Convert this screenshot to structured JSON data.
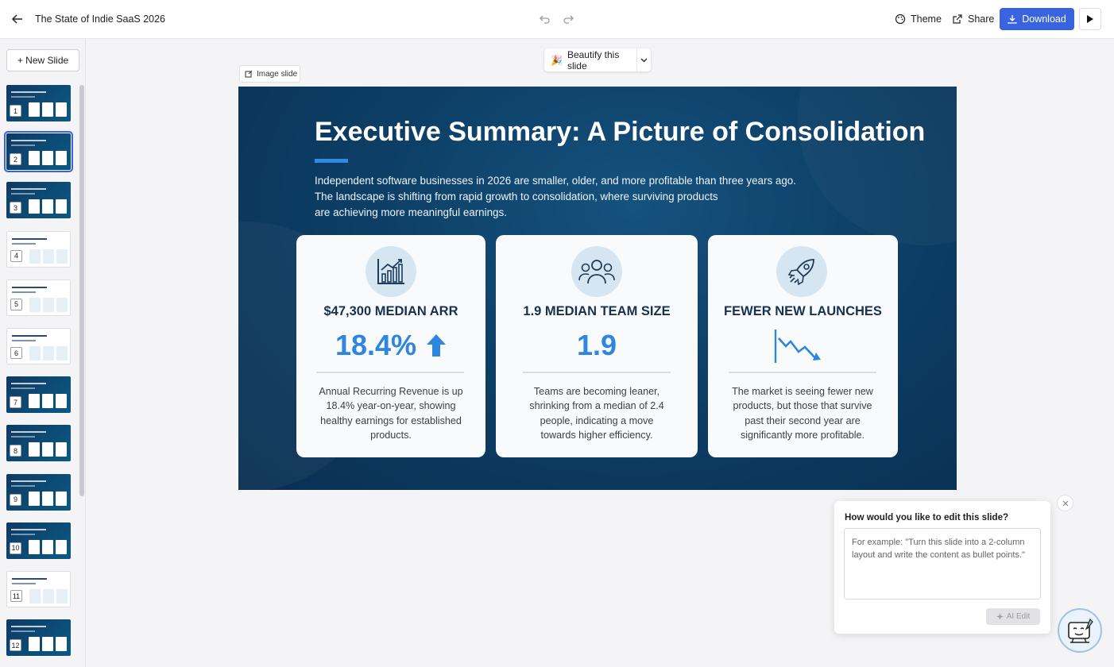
{
  "header": {
    "title": "The State of Indie SaaS 2026",
    "theme_label": "Theme",
    "share_label": "Share",
    "download_label": "Download"
  },
  "sidebar": {
    "new_slide_label": "+ New Slide",
    "selected_index": 2,
    "thumbnails": [
      {
        "number": "1",
        "style": "dark"
      },
      {
        "number": "2",
        "style": "dark"
      },
      {
        "number": "3",
        "style": "dark"
      },
      {
        "number": "4",
        "style": "light"
      },
      {
        "number": "5",
        "style": "light"
      },
      {
        "number": "6",
        "style": "light"
      },
      {
        "number": "7",
        "style": "dark"
      },
      {
        "number": "8",
        "style": "dark"
      },
      {
        "number": "9",
        "style": "dark"
      },
      {
        "number": "10",
        "style": "dark"
      },
      {
        "number": "11",
        "style": "light"
      },
      {
        "number": "12",
        "style": "dark"
      }
    ]
  },
  "canvas": {
    "beautify_label": "Beautify this slide",
    "image_slide_label": "Image slide"
  },
  "slide": {
    "title": "Executive Summary: A Picture of Consolidation",
    "intro_lines": [
      "Independent software businesses in 2026 are smaller, older, and more profitable than three years ago.",
      "The landscape is shifting from rapid growth to consolidation, where surviving products",
      "are achieving more meaningful earnings."
    ],
    "cards": [
      {
        "icon": "chart-growth-icon",
        "heading": "$47,300 MEDIAN ARR",
        "big_value": "18.4%",
        "trend": "up-arrow-icon",
        "description": "Annual Recurring Revenue is up 18.4% year-on-year, showing healthy earnings for established products."
      },
      {
        "icon": "team-icon",
        "heading": "1.9 MEDIAN TEAM SIZE",
        "big_value": "1.9",
        "description": "Teams are becoming leaner, shrinking from a median of 2.4 people, indicating a move towards higher efficiency."
      },
      {
        "icon": "rocket-icon",
        "heading": "FEWER NEW LAUNCHES",
        "big_value": "",
        "trend": "downtrend-chart-icon",
        "description": "The market is seeing fewer new products, but those that survive past their second year are significantly more profitable."
      }
    ]
  },
  "edit_panel": {
    "question": "How would you like to edit this slide?",
    "placeholder": "For example: \"Turn this slide into a 2-column layout and write the content as bullet points.\"",
    "value": "",
    "ai_edit_label": "AI Edit"
  },
  "colors": {
    "primary": "#3a63e0",
    "slide_bg": "#0d3f66",
    "accent_blue": "#2f86de"
  }
}
